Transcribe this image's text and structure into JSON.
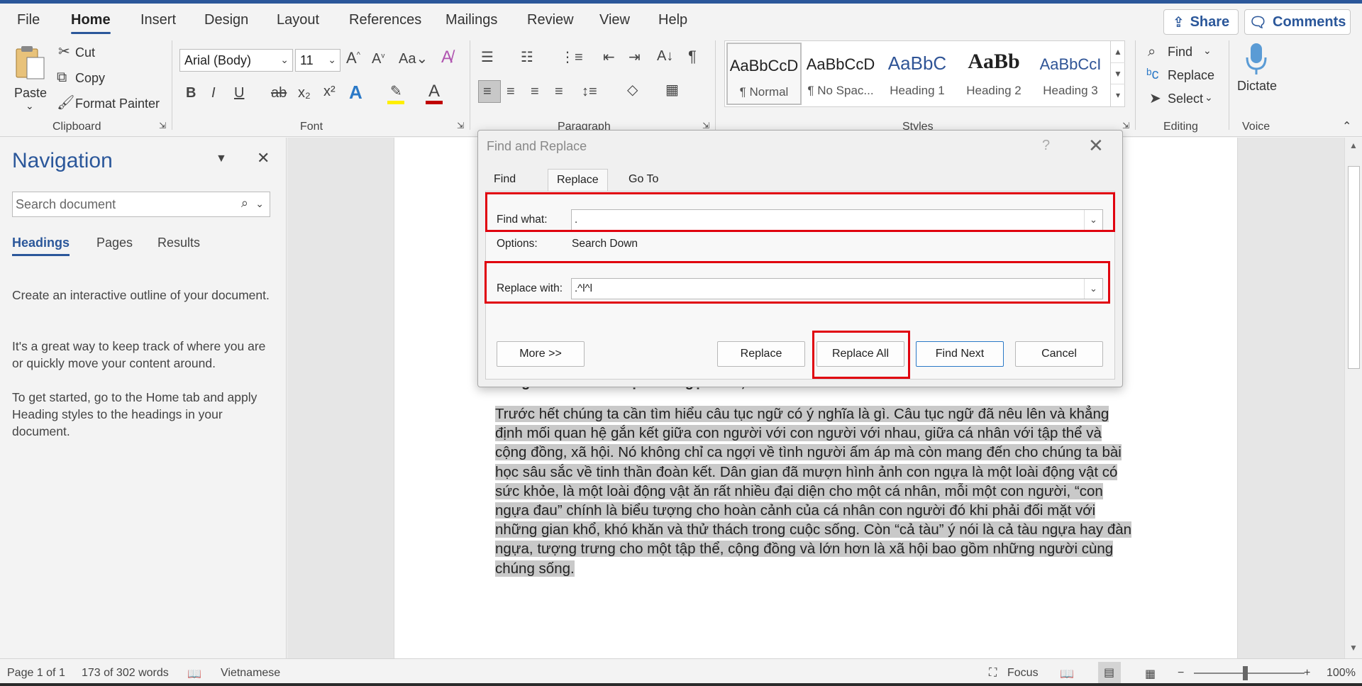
{
  "menu": {
    "tabs": [
      "File",
      "Home",
      "Insert",
      "Design",
      "Layout",
      "References",
      "Mailings",
      "Review",
      "View",
      "Help"
    ],
    "share_label": "Share",
    "comments_label": "Comments"
  },
  "ribbon": {
    "clipboard": {
      "paste": "Paste",
      "cut": "Cut",
      "copy": "Copy",
      "format_painter": "Format Painter",
      "label": "Clipboard"
    },
    "font": {
      "font_name": "Arial (Body)",
      "font_size": "11",
      "label": "Font"
    },
    "paragraph": {
      "label": "Paragraph"
    },
    "styles": {
      "label": "Styles",
      "items": [
        {
          "sample": "AaBbCcD",
          "name": "¶ Normal"
        },
        {
          "sample": "AaBbCcD",
          "name": "¶ No Spac..."
        },
        {
          "sample": "AaBbC",
          "name": "Heading 1"
        },
        {
          "sample": "AaBb",
          "name": "Heading 2"
        },
        {
          "sample": "AaBbCcI",
          "name": "Heading 3"
        }
      ]
    },
    "editing": {
      "find": "Find",
      "replace": "Replace",
      "select": "Select",
      "label": "Editing"
    },
    "voice": {
      "dictate": "Dictate",
      "label": "Voice"
    }
  },
  "navigation": {
    "title": "Navigation",
    "search_placeholder": "Search document",
    "tabs": [
      "Headings",
      "Pages",
      "Results"
    ],
    "paragraphs": [
      "Create an interactive outline of your document.",
      "It's a great way to keep track of where you are or quickly move your content around.",
      "To get started, go to the Home tab and apply Heading styles to the headings in your document."
    ]
  },
  "document": {
    "peek_right_1": "g",
    "peek_right_2": "n",
    "heading": "Ý nghĩa của câu \"Một con ngựa đau, cả tàu bỏ cỏ\"",
    "body": "Trước hết chúng ta cần tìm hiểu câu tục ngữ có ý nghĩa là gì. Câu tục ngữ đã nêu lên và khẳng định mối quan hệ gắn kết giữa con người với con người với nhau, giữa cá nhân với tập thể và cộng đồng, xã hội. Nó không chỉ ca ngợi về tình người ấm áp mà còn mang đến cho chúng ta bài học sâu sắc về tinh thần đoàn kết. Dân gian đã mượn hình ảnh con ngựa là một loài động vật có sức khỏe, là một loài động vật ăn rất nhiều đại diện cho một cá nhân, mỗi một con người, “con ngựa đau” chính là biểu tượng cho hoàn cảnh của cá nhân con người đó khi phải đối mặt với những gian khổ, khó khăn và thử thách trong cuộc sống. Còn “cả tàu” ý nói là cả tàu ngựa hay đàn ngựa, tượng trưng cho một tập thể, cộng đồng và lớn hơn là xã hội bao gồm những người cùng chúng sống."
  },
  "dialog": {
    "title": "Find and Replace",
    "help": "?",
    "tabs": [
      "Find",
      "Replace",
      "Go To"
    ],
    "find_label": "Find what:",
    "find_value": ".",
    "options_label": "Options:",
    "options_value": "Search Down",
    "replace_label": "Replace with:",
    "replace_value": ".^l^l",
    "buttons": {
      "more": "More >>",
      "replace": "Replace",
      "replace_all": "Replace All",
      "find_next": "Find Next",
      "cancel": "Cancel"
    }
  },
  "status": {
    "page": "Page 1 of 1",
    "words": "173 of 302 words",
    "language": "Vietnamese",
    "focus": "Focus",
    "zoom": "100%"
  },
  "colors": {
    "accent": "#2b579a",
    "highlight_box": "#e0000e"
  }
}
